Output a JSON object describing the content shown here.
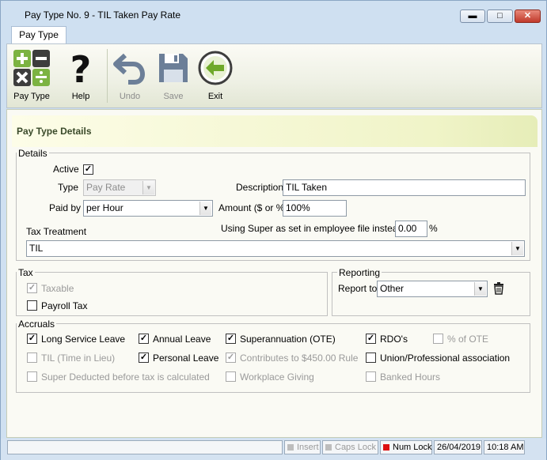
{
  "window": {
    "title": "Pay Type No. 9 - TIL Taken Pay Rate",
    "minimize": "▬",
    "maximize": "□",
    "close": "✕"
  },
  "ribbon": {
    "tab": "Pay Type",
    "tools": [
      {
        "label": "Pay Type",
        "icon": "calculator-icon"
      },
      {
        "label": "Help",
        "icon": "question-icon"
      },
      {
        "label": "Undo",
        "icon": "undo-icon"
      },
      {
        "label": "Save",
        "icon": "save-icon"
      },
      {
        "label": "Exit",
        "icon": "exit-icon"
      }
    ]
  },
  "header": {
    "title": "Pay Type Details"
  },
  "details": {
    "legend": "Details",
    "active_label": "Active",
    "active_checked": true,
    "type_label": "Type",
    "type_value": "Pay Rate",
    "description_label": "Description",
    "description_value": "TIL Taken",
    "paid_by_label": "Paid by",
    "paid_by_value": "per Hour",
    "amount_label": "Amount ($ or %)",
    "amount_value": "100%",
    "tax_treatment_label": "Tax Treatment",
    "super_label": "Using Super as set in employee file instead of",
    "super_value": "0.00",
    "super_unit": "%",
    "tax_treatment_value": "TIL"
  },
  "tax": {
    "legend": "Tax",
    "taxable_label": "Taxable",
    "taxable_checked": true,
    "payroll_tax_label": "Payroll Tax",
    "payroll_tax_checked": false
  },
  "reporting": {
    "legend": "Reporting",
    "report_to_label": "Report to",
    "report_to_value": "Other"
  },
  "accruals": {
    "legend": "Accruals",
    "items": [
      {
        "label": "Long Service Leave",
        "checked": true,
        "enabled": true
      },
      {
        "label": "Annual Leave",
        "checked": true,
        "enabled": true
      },
      {
        "label": "Superannuation (OTE)",
        "checked": true,
        "enabled": true
      },
      {
        "label": "RDO's",
        "checked": true,
        "enabled": true
      },
      {
        "label": "% of OTE",
        "checked": false,
        "enabled": false
      },
      {
        "label": "TIL (Time in Lieu)",
        "checked": false,
        "enabled": false
      },
      {
        "label": "Personal Leave",
        "checked": true,
        "enabled": true
      },
      {
        "label": "Contributes to $450.00 Rule",
        "checked": true,
        "enabled": false
      },
      {
        "label": "Union/Professional association",
        "checked": false,
        "enabled": true
      },
      {
        "label": "Super Deducted before tax is calculated",
        "checked": false,
        "enabled": false
      },
      {
        "label": "Workplace Giving",
        "checked": false,
        "enabled": false
      },
      {
        "label": "Banked Hours",
        "checked": false,
        "enabled": false
      }
    ]
  },
  "statusbar": {
    "insert": "Insert",
    "caps_lock": "Caps Lock",
    "num_lock": "Num Lock",
    "date": "26/04/2019",
    "time": "10:18 AM"
  },
  "colors": {
    "num_lock_led": "#dd1111",
    "exit_icon": "#6fa92a",
    "calc_green": "#7cb342"
  }
}
